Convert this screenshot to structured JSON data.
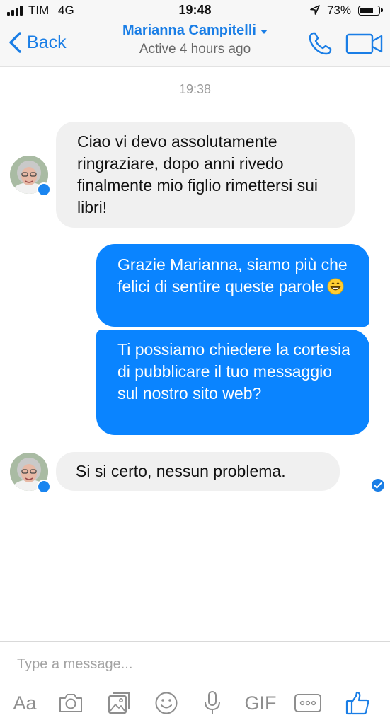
{
  "status_bar": {
    "carrier": "TIM",
    "network": "4G",
    "time": "19:48",
    "battery_percent": "73%",
    "battery_level": 0.73
  },
  "header": {
    "back_label": "Back",
    "contact_name": "Marianna Campitelli",
    "contact_status": "Active 4 hours ago"
  },
  "conversation": {
    "timestamp": "19:38",
    "messages": [
      {
        "direction": "incoming",
        "text": "Ciao vi devo assolutamente ringraziare, dopo anni rivedo finalmente mio figlio rimettersi sui libri!"
      },
      {
        "direction": "outgoing",
        "text": "Grazie Marianna, siamo più che felici di sentire queste parole",
        "emoji": "grinning-face-icon"
      },
      {
        "direction": "outgoing",
        "text": "Ti possiamo chiedere la cortesia di pubblicare il tuo messaggio sul nostro sito web?"
      },
      {
        "direction": "incoming",
        "text": "Si si certo, nessun problema."
      }
    ]
  },
  "composer": {
    "placeholder": "Type a message...",
    "tools": [
      {
        "label": "Aa",
        "icon": "text-format-icon"
      },
      {
        "icon": "camera-icon"
      },
      {
        "icon": "gallery-icon"
      },
      {
        "icon": "emoji-icon"
      },
      {
        "icon": "microphone-icon"
      },
      {
        "label": "GIF",
        "icon": "gif-icon"
      },
      {
        "icon": "more-icon"
      },
      {
        "icon": "thumbs-up-icon"
      }
    ]
  },
  "colors": {
    "accent": "#1a7ee6",
    "outgoing_bubble": "#0a84ff",
    "incoming_bubble": "#f0f0f0",
    "bar_background": "#f7f7f7",
    "icon_gray": "#8e8e8e"
  }
}
